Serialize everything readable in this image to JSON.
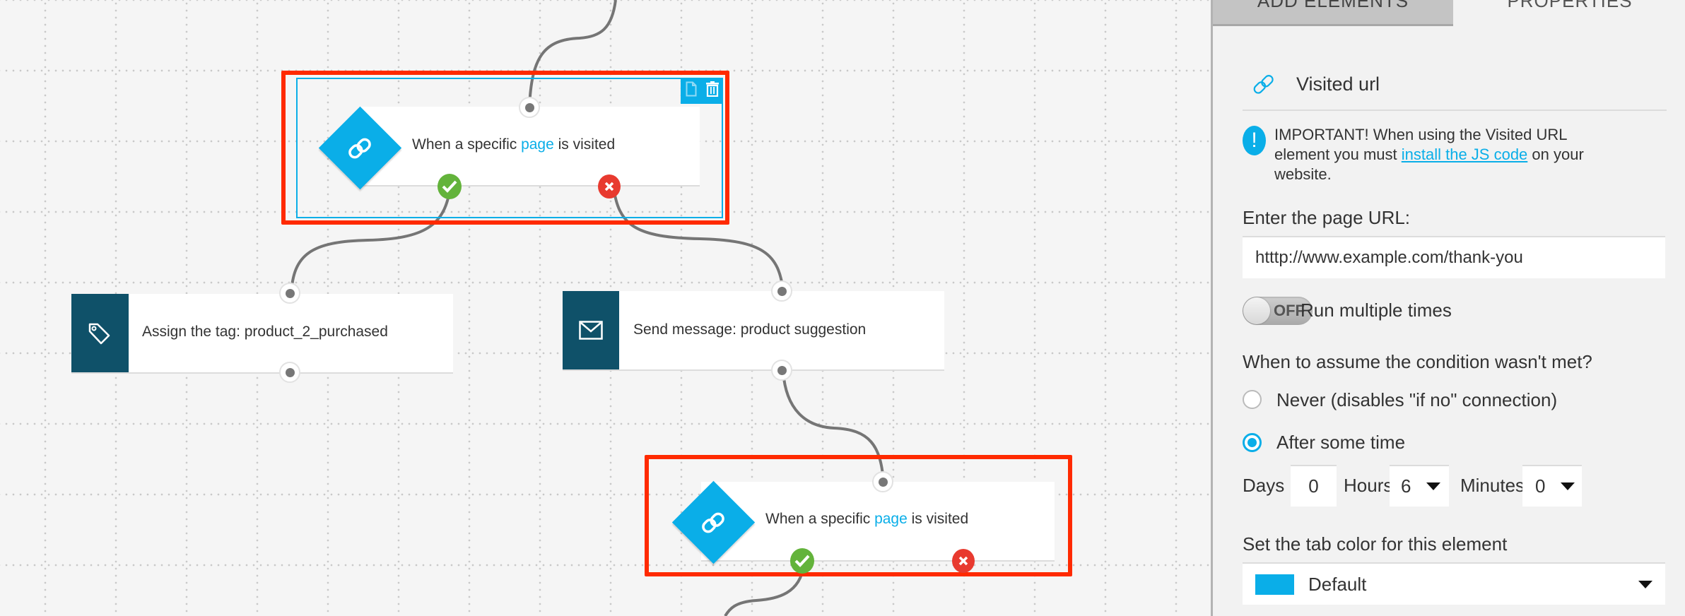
{
  "canvas": {
    "nodes": [
      {
        "id": "cond-1",
        "type": "condition",
        "icon": "link-icon",
        "text_before": "When a specific ",
        "text_link": "page",
        "text_after": " is visited",
        "selected": true,
        "highlighted": true
      },
      {
        "id": "action-tag",
        "type": "action",
        "icon": "tag-icon",
        "text": "Assign the tag: product_2_purchased"
      },
      {
        "id": "action-msg",
        "type": "action",
        "icon": "envelope-icon",
        "text": "Send message: product suggestion"
      },
      {
        "id": "cond-2",
        "type": "condition",
        "icon": "link-icon",
        "text_before": "When a specific ",
        "text_link": "page",
        "text_after": " is visited",
        "selected": false,
        "highlighted": true
      }
    ],
    "node_toolbar": {
      "copy_icon": "copy-icon",
      "delete_icon": "trash-icon"
    },
    "ports": {
      "yes_icon": "check-icon",
      "no_icon": "x-icon"
    }
  },
  "panel": {
    "tabs": [
      {
        "label": "ADD ELEMENTS",
        "active": false
      },
      {
        "label": "PROPERTIES",
        "active": true
      }
    ],
    "title_icon": "link-icon",
    "title": "Visited url",
    "notice": {
      "icon": "info-icon",
      "icon_glyph": "!",
      "text_before": "IMPORTANT! When using the Visited URL element you must ",
      "link": "install the JS code",
      "text_after": " on your website."
    },
    "url_label": "Enter the page URL:",
    "url_value": "htttp://www.example.com/thank-you",
    "toggle": {
      "state": "OFF",
      "label": "Run multiple times"
    },
    "condition_question": "When to assume the condition wasn't met?",
    "radio_options": [
      {
        "label": "Never (disables \"if no\" connection)",
        "selected": false
      },
      {
        "label": "After some time",
        "selected": true
      }
    ],
    "timing": {
      "days_label": "Days",
      "days_value": "0",
      "hours_label": "Hours",
      "hours_value": "6",
      "minutes_label": "Minutes",
      "minutes_value": "0"
    },
    "tab_color_label": "Set the tab color for this element",
    "tab_color": {
      "value": "Default",
      "swatch": "#0aaee8"
    }
  },
  "colors": {
    "accent": "#0aaee8",
    "action_tab": "#0f5169",
    "yes": "#63b33b",
    "no": "#e83a2f",
    "highlight": "#ff2a00"
  }
}
